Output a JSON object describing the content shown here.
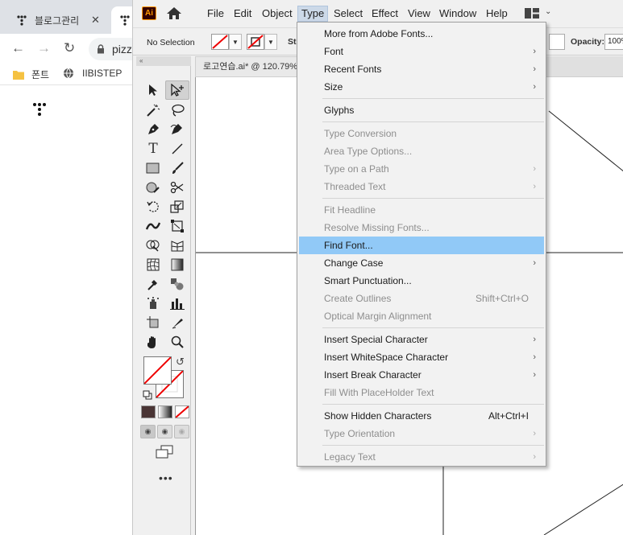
{
  "browser": {
    "tab_title": "블로그관리",
    "tab_close": "✕",
    "omnibox_text": "pizz",
    "bookmarks": [
      {
        "icon": "folder-icon",
        "label": "폰트"
      },
      {
        "icon": "globe-icon",
        "label": "IIBISTEP"
      }
    ]
  },
  "app": {
    "logo_text": "Ai",
    "menus": [
      "File",
      "Edit",
      "Object",
      "Type",
      "Select",
      "Effect",
      "View",
      "Window",
      "Help"
    ],
    "active_menu": "Type",
    "control_bar": {
      "selection_label": "No Selection",
      "stroke_label_fragment": "Str",
      "opacity_label": "Opacity:",
      "opacity_value": "100%"
    },
    "document_tab": "로고연습.ai* @ 120.79%"
  },
  "type_menu": {
    "groups": [
      [
        {
          "label": "More from Adobe Fonts...",
          "enabled": true,
          "submenu": false
        },
        {
          "label": "Font",
          "enabled": true,
          "submenu": true
        },
        {
          "label": "Recent Fonts",
          "enabled": true,
          "submenu": true
        },
        {
          "label": "Size",
          "enabled": true,
          "submenu": true
        }
      ],
      [
        {
          "label": "Glyphs",
          "enabled": true,
          "submenu": false
        }
      ],
      [
        {
          "label": "Type Conversion",
          "enabled": false,
          "submenu": false
        },
        {
          "label": "Area Type Options...",
          "enabled": false,
          "submenu": false
        },
        {
          "label": "Type on a Path",
          "enabled": false,
          "submenu": true
        },
        {
          "label": "Threaded Text",
          "enabled": false,
          "submenu": true
        }
      ],
      [
        {
          "label": "Fit Headline",
          "enabled": false,
          "submenu": false
        },
        {
          "label": "Resolve Missing Fonts...",
          "enabled": false,
          "submenu": false
        },
        {
          "label": "Find Font...",
          "enabled": true,
          "submenu": false,
          "highlighted": true
        },
        {
          "label": "Change Case",
          "enabled": true,
          "submenu": true
        },
        {
          "label": "Smart Punctuation...",
          "enabled": true,
          "submenu": false
        },
        {
          "label": "Create Outlines",
          "enabled": false,
          "submenu": false,
          "shortcut": "Shift+Ctrl+O"
        },
        {
          "label": "Optical Margin Alignment",
          "enabled": false,
          "submenu": false
        }
      ],
      [
        {
          "label": "Insert Special Character",
          "enabled": true,
          "submenu": true
        },
        {
          "label": "Insert WhiteSpace Character",
          "enabled": true,
          "submenu": true
        },
        {
          "label": "Insert Break Character",
          "enabled": true,
          "submenu": true
        },
        {
          "label": "Fill With PlaceHolder Text",
          "enabled": false,
          "submenu": false
        }
      ],
      [
        {
          "label": "Show Hidden Characters",
          "enabled": true,
          "submenu": false,
          "shortcut": "Alt+Ctrl+I"
        },
        {
          "label": "Type Orientation",
          "enabled": false,
          "submenu": true
        }
      ],
      [
        {
          "label": "Legacy Text",
          "enabled": false,
          "submenu": true
        }
      ]
    ]
  }
}
